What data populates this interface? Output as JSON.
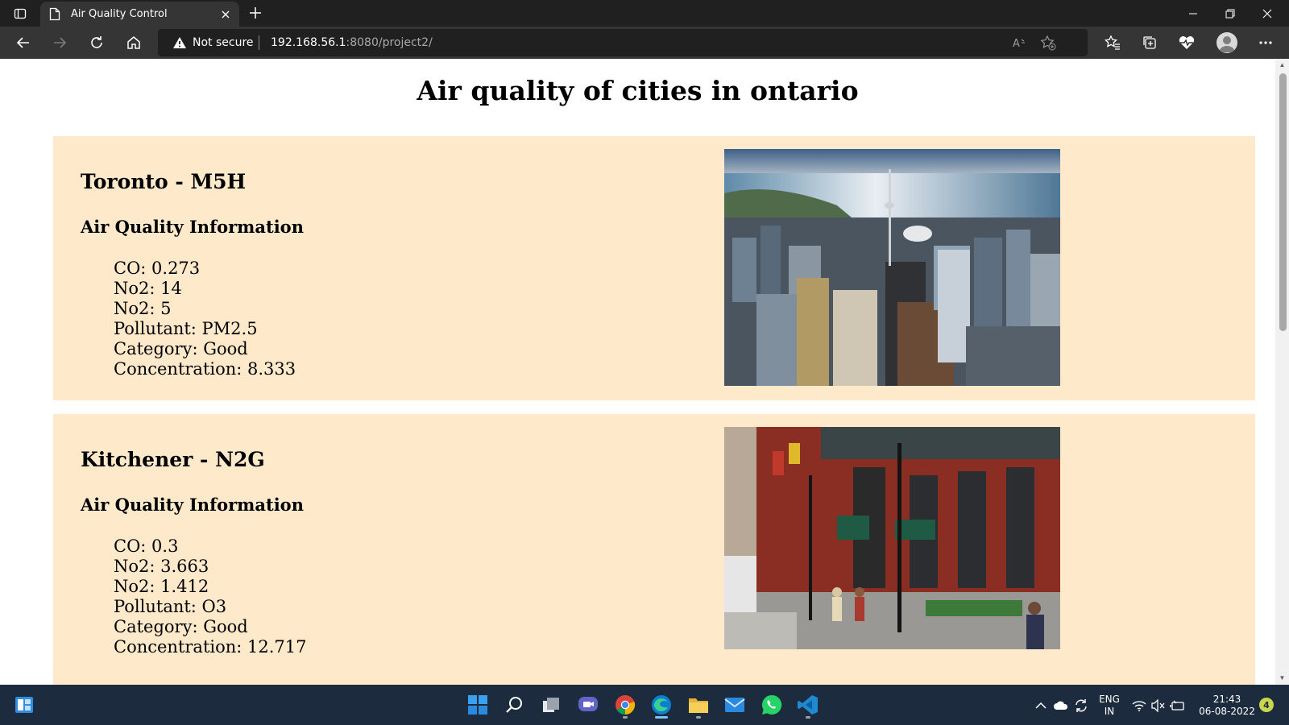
{
  "browser": {
    "tab_title": "Air Quality Control",
    "security_label": "Not secure",
    "url_host": "192.168.56.1",
    "url_rest": ":8080/project2/"
  },
  "page": {
    "title": "Air quality of cities in ontario",
    "cities": [
      {
        "name": "Toronto - M5H",
        "section_heading": "Air Quality Information",
        "readings": [
          "CO: 0.273",
          "No2: 14",
          "No2: 5",
          "Pollutant: PM2.5",
          "Category: Good",
          "Concentration: 8.333"
        ],
        "photo": "toronto-skyline-photo"
      },
      {
        "name": "Kitchener - N2G",
        "section_heading": "Air Quality Information",
        "readings": [
          "CO: 0.3",
          "No2: 3.663",
          "No2: 1.412",
          "Pollutant: O3",
          "Category: Good",
          "Concentration: 12.717"
        ],
        "photo": "kitchener-street-photo"
      }
    ]
  },
  "taskbar": {
    "language": "ENG",
    "region": "IN",
    "time": "21:43",
    "date": "06-08-2022",
    "notification_count": "4",
    "apps": [
      "start-icon",
      "search-icon",
      "task-view-icon",
      "teams-chat-icon",
      "chrome-icon",
      "edge-icon",
      "file-explorer-icon",
      "mail-icon",
      "whatsapp-icon",
      "vscode-icon"
    ]
  },
  "colors": {
    "card_background": "#ffe9cb",
    "browser_chrome": "#202020",
    "toolbar": "#353535",
    "taskbar": "#1c2c3e"
  }
}
